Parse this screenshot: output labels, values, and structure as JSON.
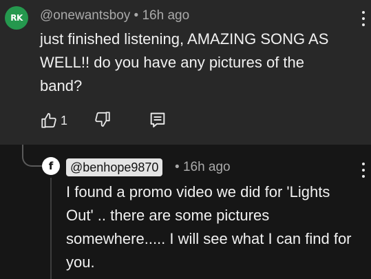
{
  "top_comment": {
    "avatar_text": "RK",
    "avatar_color": "#25984e",
    "handle": "@onewantsboy",
    "separator": "•",
    "time": "16h ago",
    "text": "just finished listening, AMAZING SONG AS WELL!! do you have any pictures of the band?",
    "like_count": "1",
    "icons": {
      "like": "thumbs-up-icon",
      "dislike": "thumbs-down-icon",
      "reply": "comment-icon",
      "menu": "more-vertical-icon"
    }
  },
  "reply": {
    "avatar_text": "f",
    "handle": "@benhope9870",
    "separator": "•",
    "time": "16h ago",
    "text": "I found a promo video we did for 'Lights Out'  .. there are some pictures somewhere..... I will see what I can find for you.",
    "icons": {
      "menu": "more-vertical-icon"
    }
  },
  "colors": {
    "top_background": "#282828",
    "reply_background": "#161616",
    "text": "#f1f1f1",
    "meta": "#aaaaaa"
  }
}
